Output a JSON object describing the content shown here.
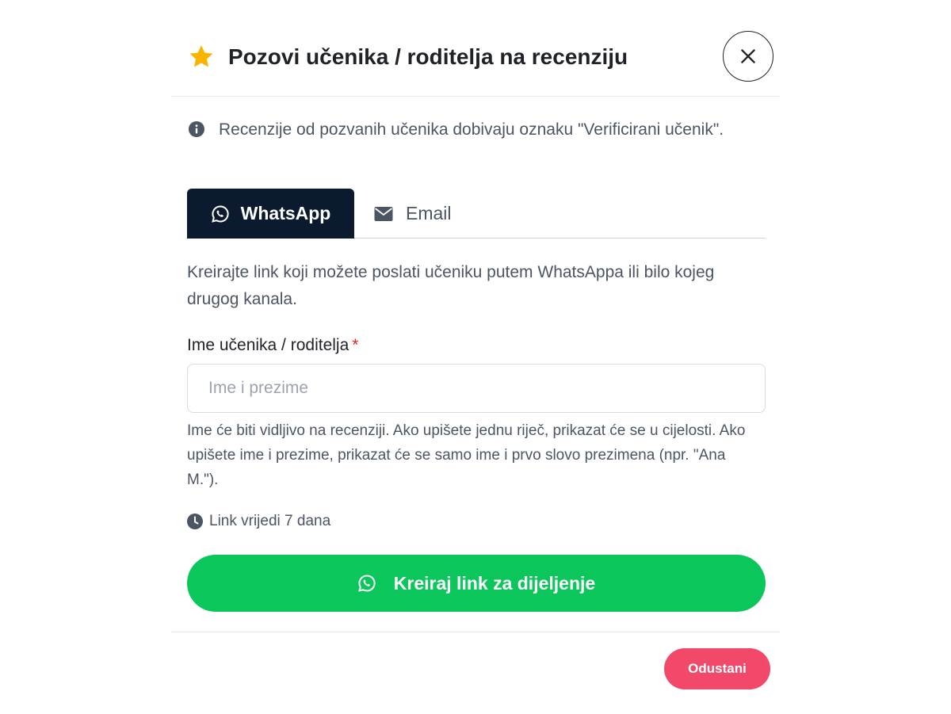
{
  "modal": {
    "title": "Pozovi učenika / roditelja na recenziju",
    "title_icon": "star-icon",
    "close_icon": "close-icon",
    "info_text": "Recenzije od pozvanih učenika dobivaju oznaku \"Verificirani učenik\".",
    "tabs": [
      {
        "label": "WhatsApp",
        "icon": "whatsapp-icon",
        "active": true
      },
      {
        "label": "Email",
        "icon": "envelope-icon",
        "active": false
      }
    ],
    "description": "Kreirajte link koji možete poslati učeniku putem WhatsAppa ili bilo kojeg drugog kanala.",
    "name_field": {
      "label": "Ime učenika / roditelja",
      "required_mark": "*",
      "placeholder": "Ime i prezime",
      "value": ""
    },
    "help_text": "Ime će biti vidljivo na recenziji. Ako upišete jednu riječ, prikazat će se u cijelosti. Ako upišete ime i prezime, prikazat će se samo ime i prvo slovo prezimena (npr. \"Ana M.\").",
    "validity_text": "Link vrijedi 7 dana",
    "cta_label": "Kreiraj link za dijeljenje",
    "cancel_label": "Odustani"
  },
  "colors": {
    "star": "#f7b500",
    "tab_active_bg": "#0b1a2e",
    "cta_green": "#0bc65a",
    "cancel_pink": "#f2496b",
    "required_red": "#e02424"
  }
}
